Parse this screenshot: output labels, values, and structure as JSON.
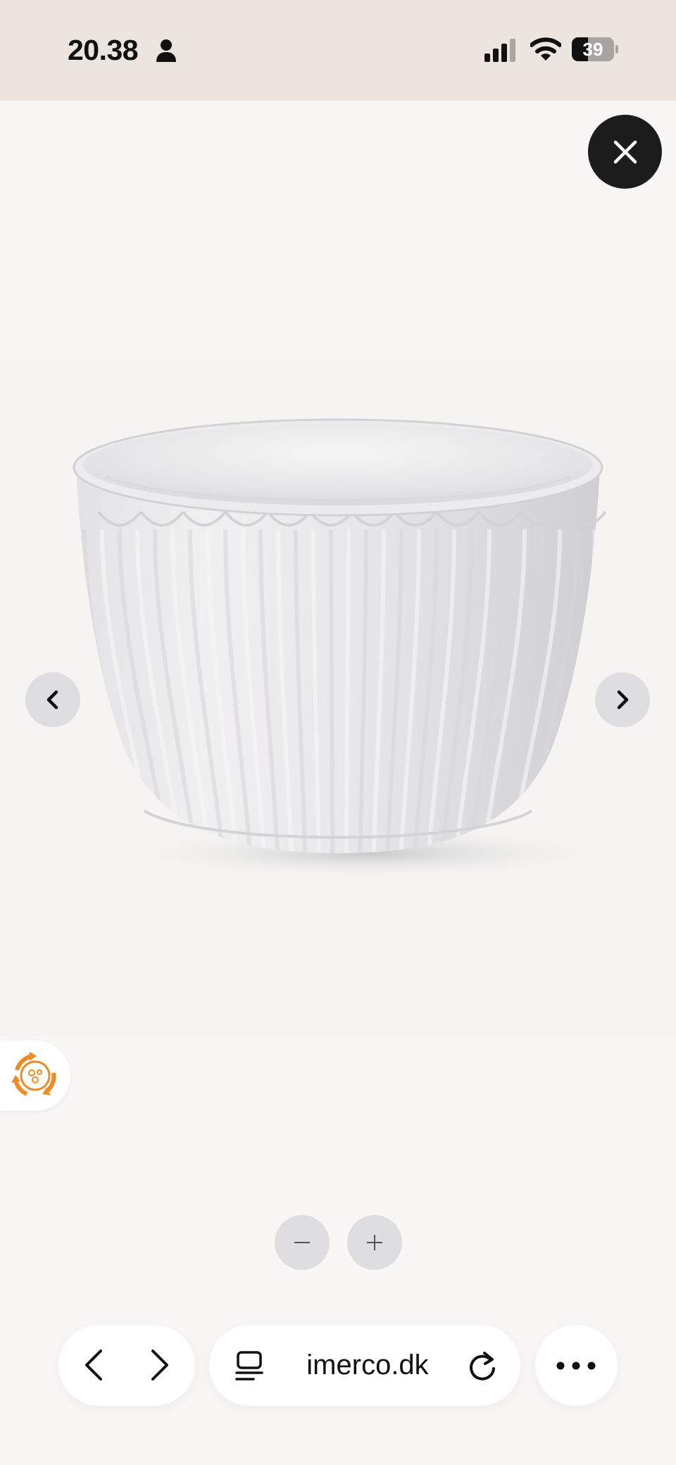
{
  "status_bar": {
    "time": "20.38",
    "battery_level": "39",
    "battery_fraction": 0.39
  },
  "browser": {
    "url": "imerco.dk"
  },
  "icons": {
    "person": "person-icon",
    "signal": "cellular-signal-icon",
    "wifi": "wifi-icon",
    "close": "close-icon",
    "prev": "chevron-left-icon",
    "next": "chevron-right-icon",
    "badge": "recycle-badge-icon",
    "zoom_out": "minus-icon",
    "zoom_in": "plus-icon",
    "back": "back-arrow-icon",
    "forward": "forward-arrow-icon",
    "tabs": "tabs-icon",
    "reload": "reload-icon",
    "more": "more-icon"
  },
  "colors": {
    "status_bar_bg": "#ece4de",
    "close_button": "#1c1c1c",
    "badge_accent": "#f08a24"
  }
}
